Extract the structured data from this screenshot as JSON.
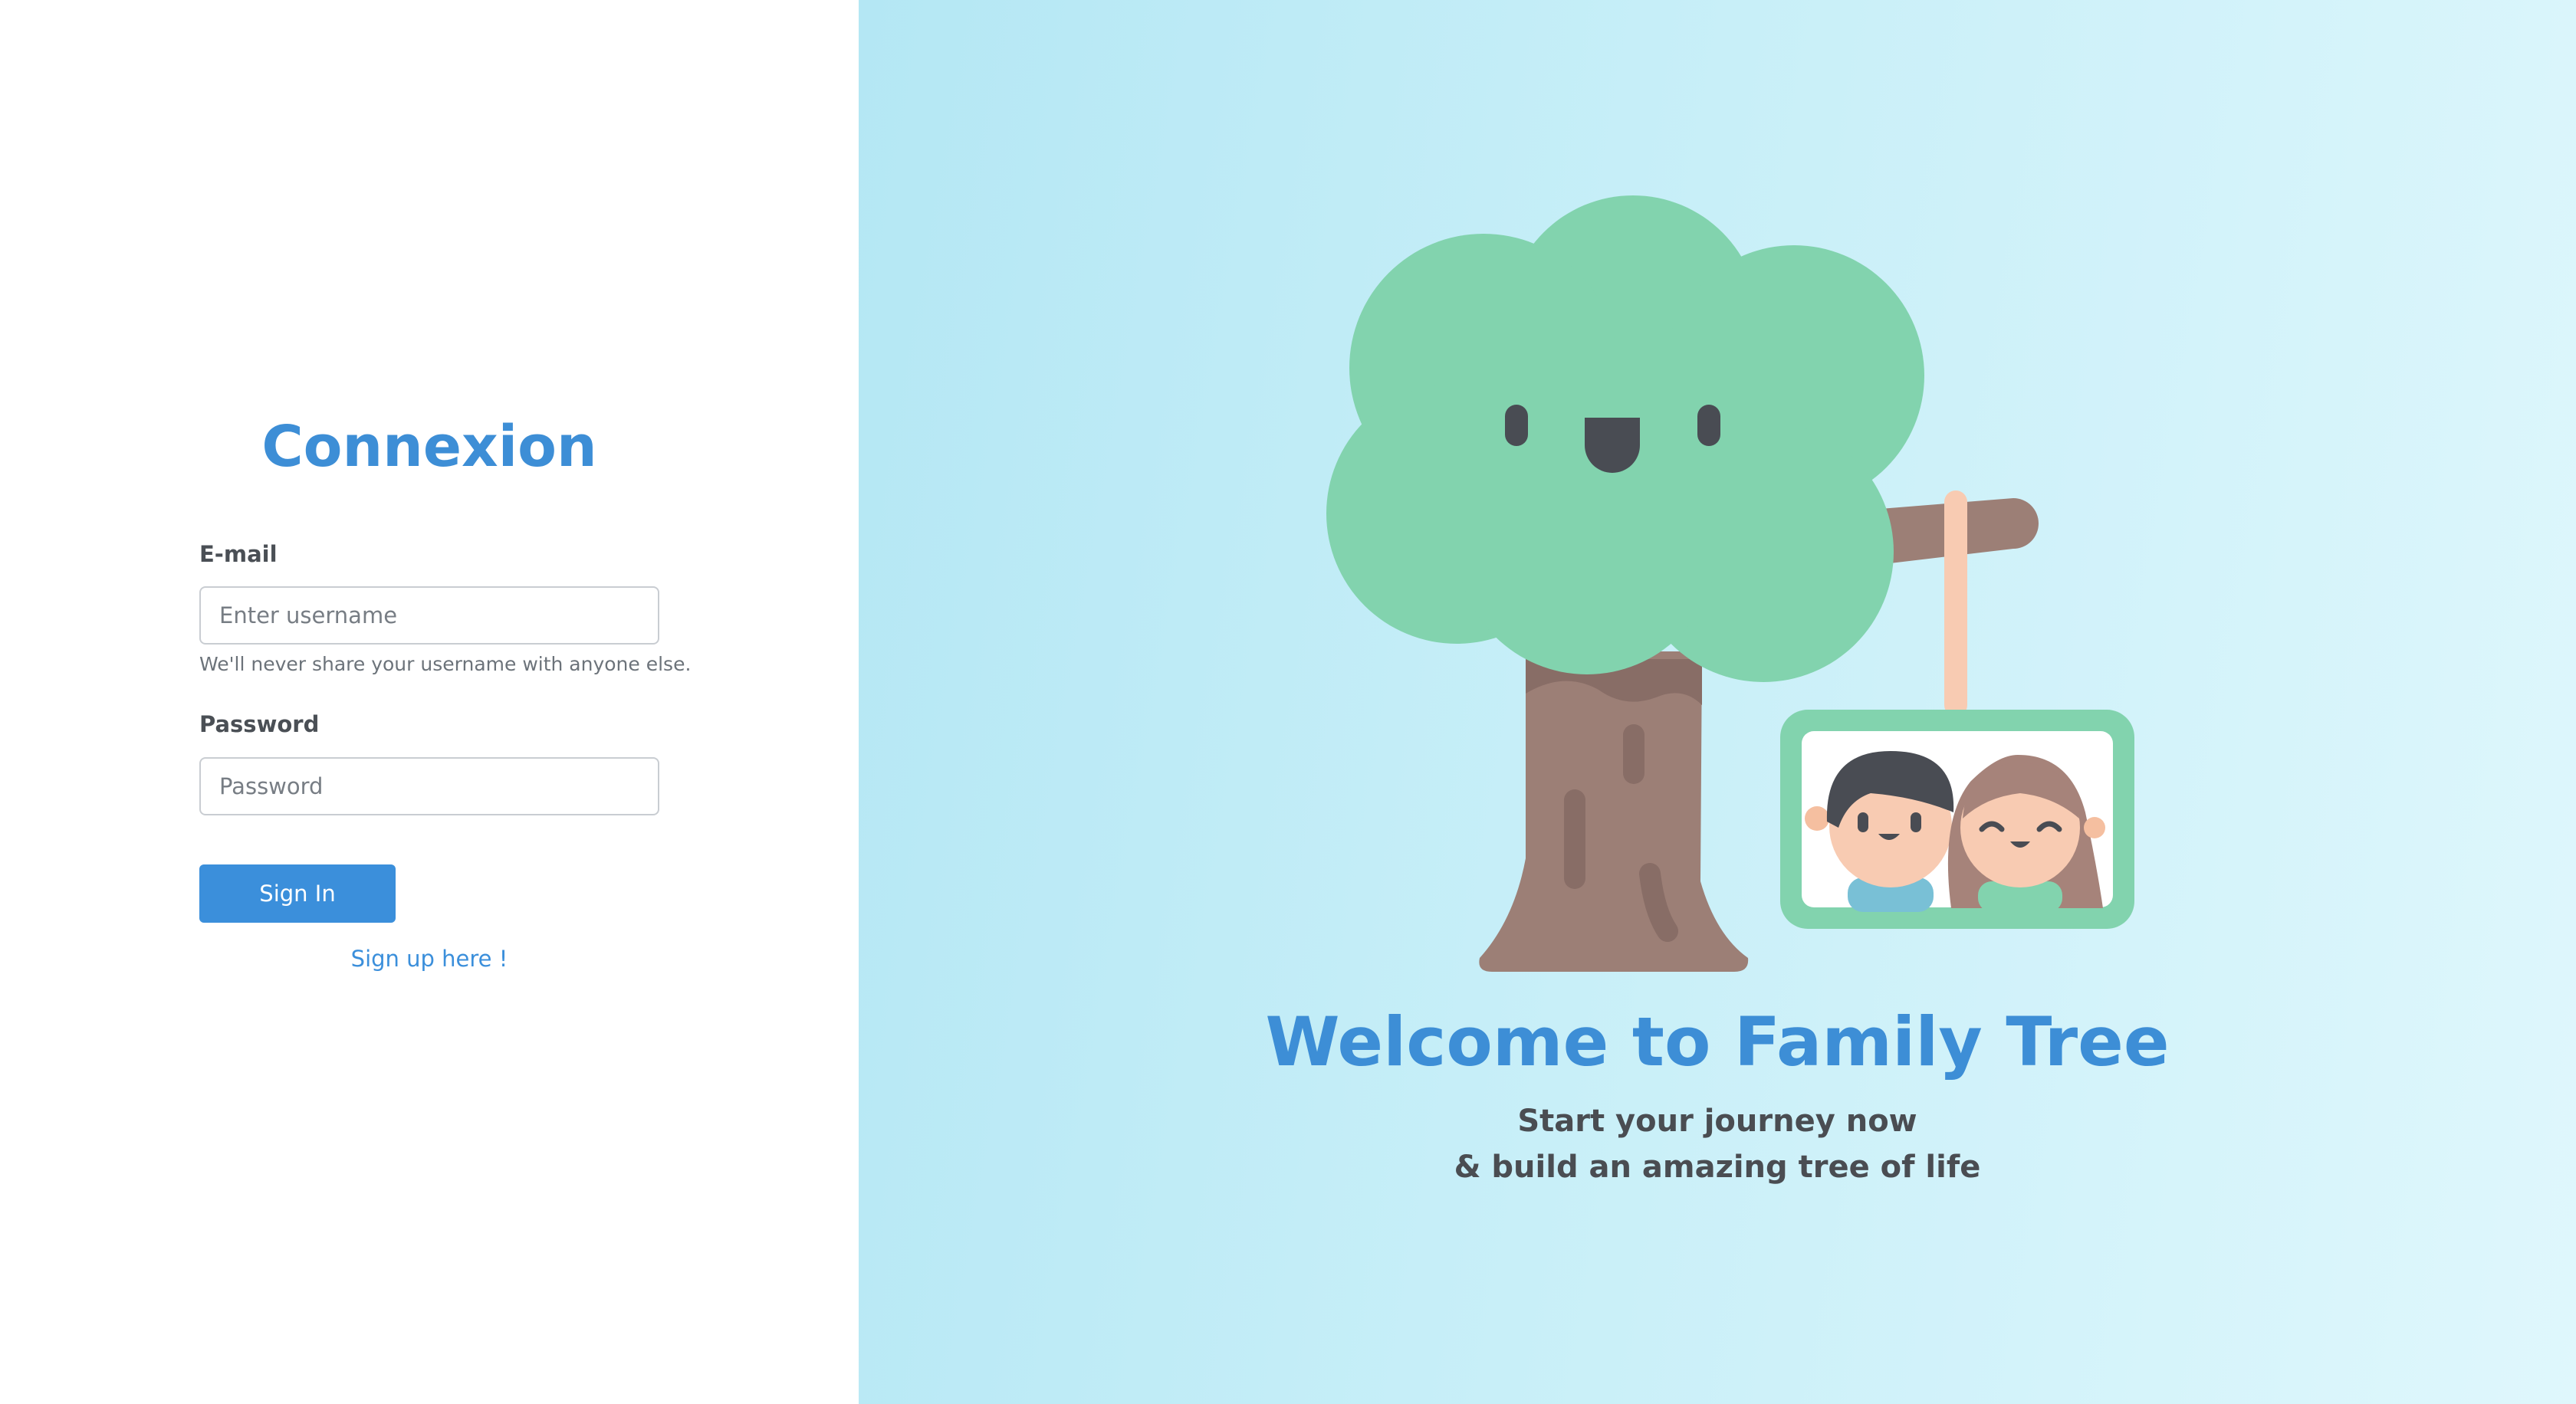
{
  "login": {
    "title": "Connexion",
    "email_label": "E-mail",
    "email_placeholder": "Enter username",
    "email_hint": "We'll never share your username with anyone else.",
    "password_label": "Password",
    "password_placeholder": "Password",
    "signin_label": "Sign In",
    "signup_label": "Sign up here !"
  },
  "hero": {
    "heading": "Welcome to Family Tree",
    "tagline_line1": "Start your journey now",
    "tagline_line2": "& build an amazing tree of life",
    "illustration": "family-tree-illustration"
  },
  "colors": {
    "accent": "#3b8fdb",
    "hero_background": "#c8eff8",
    "tree_foliage": "#82d3ae",
    "tree_trunk": "#9c7f76"
  }
}
